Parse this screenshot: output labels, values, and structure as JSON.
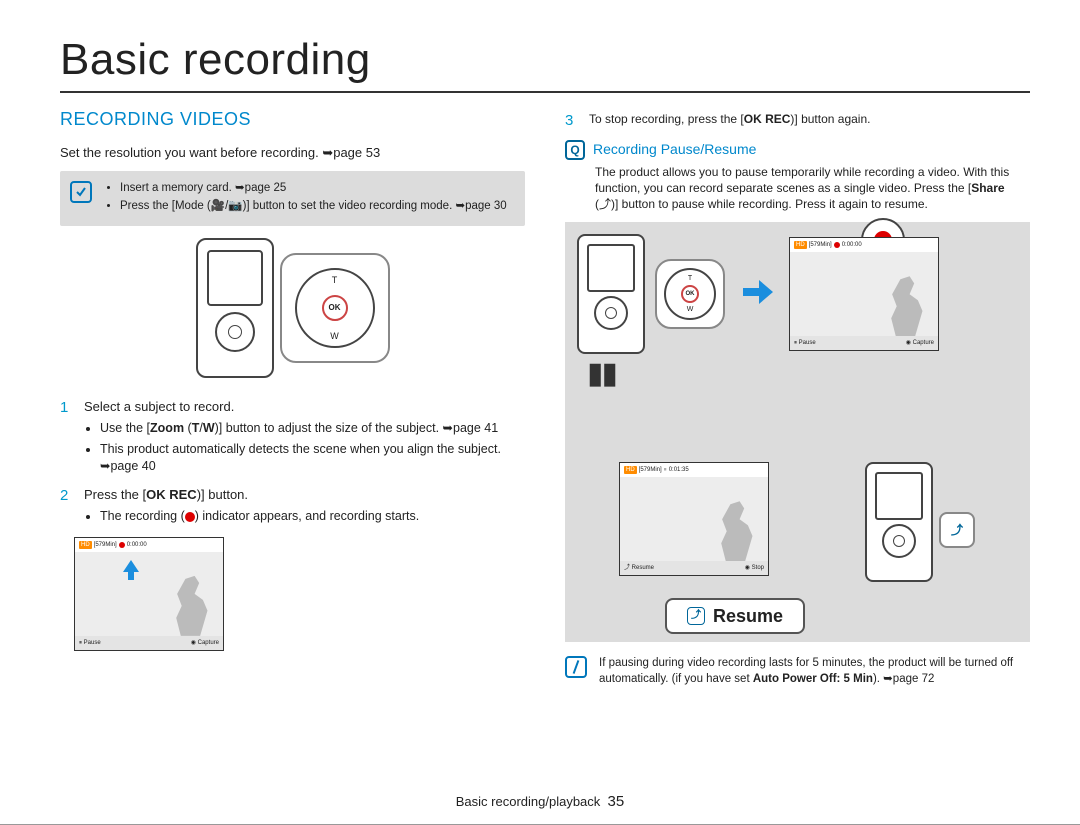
{
  "page": {
    "title": "Basic recording",
    "footer_prefix": "Basic recording/playback",
    "page_number": "35"
  },
  "left": {
    "heading": "RECORDING VIDEOS",
    "intro": "Set the resolution you want before recording. ➥page 53",
    "callout": {
      "items": [
        "Insert a memory card. ➥page 25",
        "Press the [Mode (🎥/📷)] button to set the video recording mode. ➥page 30"
      ]
    },
    "dpad": {
      "t": "T",
      "w": "W",
      "ok": "OK"
    },
    "steps": [
      {
        "num": "1",
        "text": "Select a subject to record.",
        "sub": [
          "Use the [Zoom (T/W)] button to adjust the size of the subject. ➥page 41",
          "This product automatically detects the scene when you align the subject. ➥page 40"
        ]
      },
      {
        "num": "2",
        "text": "Press the [OK REC)] button.",
        "sub": [
          "The recording (●) indicator appears, and recording starts."
        ]
      }
    ],
    "preview": {
      "badge": "HD",
      "mins": "[579Min]",
      "time": "0:00:00",
      "hd": "HD",
      "pause": "Pause",
      "capture": "Capture"
    }
  },
  "right": {
    "step3": {
      "num": "3",
      "text": "To stop recording, press the [OK REC)] button again."
    },
    "subhead": "Recording Pause/Resume",
    "desc": "The product allows you to pause temporarily while recording a video. With this function, you can record separate scenes as a single video. Press the [Share (⤴)] button to pause while recording. Press it again to resume.",
    "preview_rec": {
      "badge": "HD",
      "mins": "[579Min]",
      "time": "0:00:00",
      "pause": "Pause",
      "capture": "Capture"
    },
    "preview_pause": {
      "badge": "HD",
      "mins": "[579Min]",
      "time": "0:01:35",
      "resume": "Resume",
      "stop": "Stop"
    },
    "resume_btn": "Resume",
    "footnote": "If pausing during video recording lasts for 5 minutes, the product will be turned off automatically. (if you have set Auto Power Off: 5 Min). ➥page 72"
  }
}
